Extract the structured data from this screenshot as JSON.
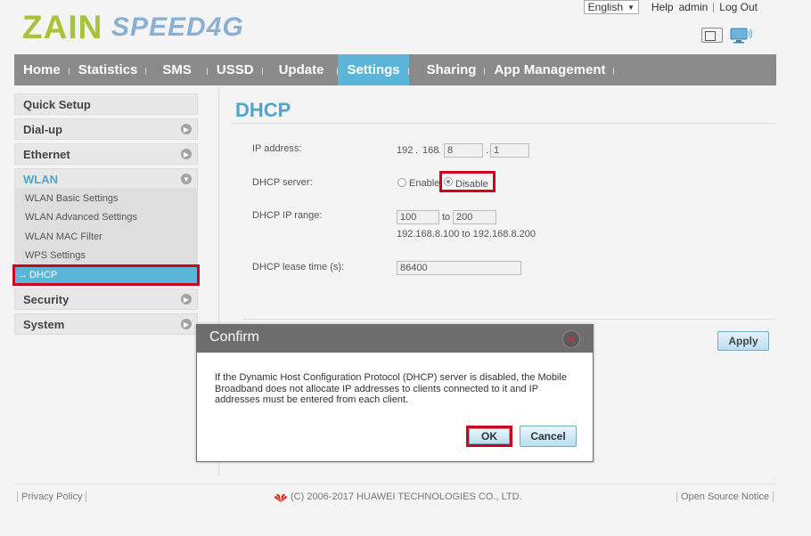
{
  "header": {
    "logo_zain": "ZAIN",
    "logo_speed": "SPEED4G",
    "language": "English",
    "help": "Help",
    "user": "admin",
    "logout": "Log Out"
  },
  "nav": {
    "items": [
      "Home",
      "Statistics",
      "SMS",
      "USSD",
      "Update",
      "Settings",
      "Sharing",
      "App Management"
    ],
    "active": "Settings"
  },
  "sidebar": {
    "quick_setup": "Quick Setup",
    "dialup": "Dial-up",
    "ethernet": "Ethernet",
    "wlan": "WLAN",
    "wlan_sub": [
      "WLAN Basic Settings",
      "WLAN Advanced Settings",
      "WLAN MAC Filter",
      "WPS Settings"
    ],
    "dhcp": "DHCP",
    "dhcp_arrow": "→",
    "security": "Security",
    "system": "System"
  },
  "main": {
    "title": "DHCP",
    "ip_label": "IP address:",
    "ip_1": "192",
    "ip_sep1": ".",
    "ip_2": "168",
    "ip_sep2": ".",
    "ip_3": "8",
    "ip_sep3": ".",
    "ip_4": "1",
    "dhcp_server_label": "DHCP server:",
    "enable": "Enable",
    "disable": "Disable",
    "range_label": "DHCP IP range:",
    "range_start": "100",
    "range_to": "to",
    "range_end": "200",
    "range_hint": "192.168.8.100 to 192.168.8.200",
    "lease_label": "DHCP lease time (s):",
    "lease_value": "86400",
    "apply": "Apply"
  },
  "dialog": {
    "title": "Confirm",
    "close": "✕",
    "message": "If the Dynamic Host Configuration Protocol (DHCP) server is disabled, the Mobile Broadband does not allocate IP addresses to clients connected to it and IP addresses must be entered from each client.",
    "ok": "OK",
    "cancel": "Cancel"
  },
  "footer": {
    "privacy": "Privacy Policy",
    "copyright": "(C) 2006-2017 HUAWEI TECHNOLOGIES CO., LTD.",
    "open_source": "Open Source Notice"
  },
  "colors": {
    "accent": "#5ab5d8",
    "highlight": "#d0021b",
    "nav_bg": "#8a8a8a"
  }
}
